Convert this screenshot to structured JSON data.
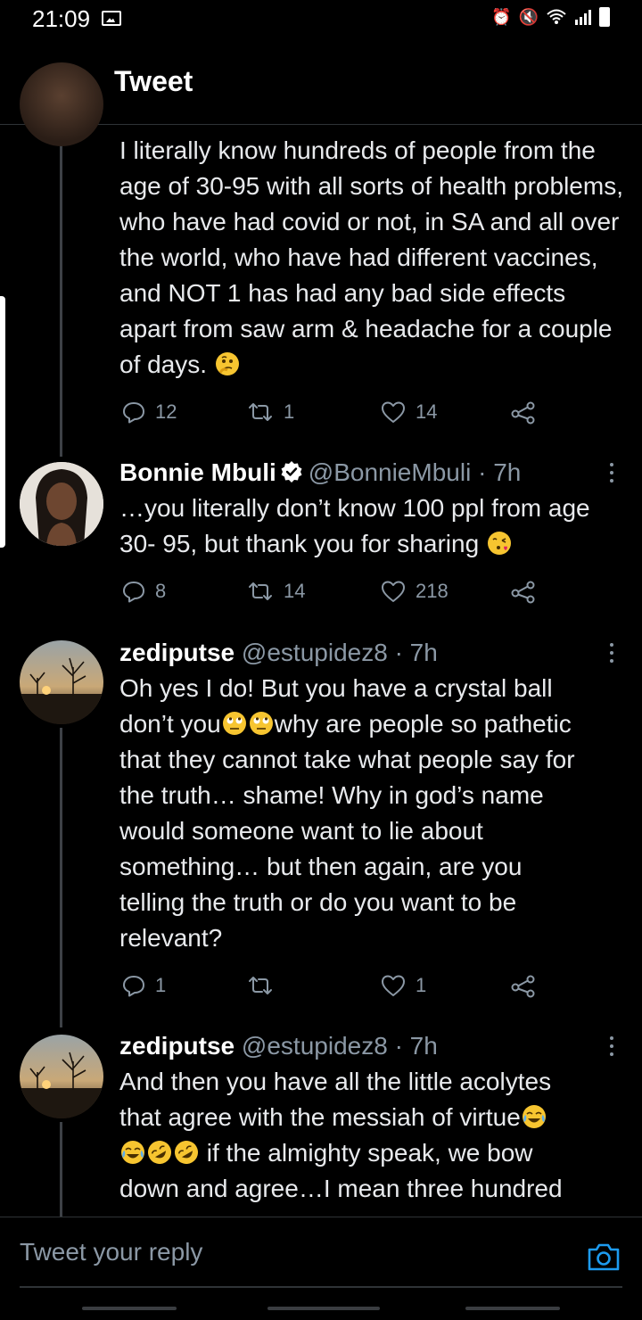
{
  "status_bar": {
    "time": "21:09"
  },
  "header": {
    "title": "Tweet"
  },
  "tweets": [
    {
      "text": "I literally know hundreds of people from the age of 30-95 with all sorts of health problems, who have had covid or not, in SA and all over the world, who have had different vaccines, and NOT 1 has had any bad side effects apart from saw arm & headache for a couple of days.",
      "emoji_after": "thinking-face-emoji",
      "replies": "12",
      "retweets": "1",
      "likes": "14"
    },
    {
      "name": "Bonnie Mbuli",
      "verified": true,
      "handle": "@BonnieMbuli",
      "sep": "·",
      "time": "7h",
      "text": "…you literally don’t know 100 ppl from age 30- 95, but thank you for sharing",
      "emoji_after": "face-blowing-kiss-emoji",
      "replies": "8",
      "retweets": "14",
      "likes": "218"
    },
    {
      "name": "zediputse",
      "handle": "@estupidez8",
      "sep": "·",
      "time": "7h",
      "text_lines": [
        "Oh yes I do! But you have a crystal ball",
        "why are people so pathetic",
        "that they cannot take what people say for",
        "the truth… shame! Why in god’s name",
        "would someone want to lie about",
        "something… but then again, are you",
        "telling the truth or do you want to be",
        "relevant?"
      ],
      "line2_prefix": "don’t you",
      "replies": "1",
      "retweets": "",
      "likes": "1"
    },
    {
      "name": "zediputse",
      "handle": "@estupidez8",
      "sep": "·",
      "time": "7h",
      "text_lines": [
        "And then you have all the little acolytes",
        "that agree with the messiah of virtue",
        " if the almighty speak, we bow",
        "down and agree…I mean three hundred"
      ]
    }
  ],
  "reply_box": {
    "placeholder": "Tweet your reply"
  },
  "colors": {
    "background": "#000000",
    "accent": "#1d9bf0",
    "muted": "#8b98a5",
    "text": "#e8eaed"
  }
}
